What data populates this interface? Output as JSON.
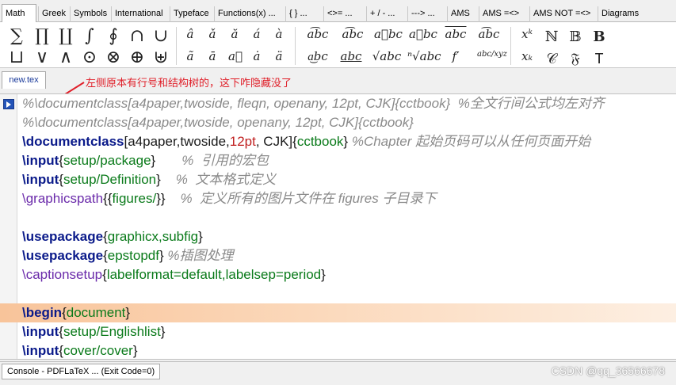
{
  "symbol_tabs": [
    "Math",
    "Greek",
    "Symbols",
    "International",
    "Typeface",
    "Functions(x) ...",
    "{ } ...",
    "<>= ...",
    "+ / - ...",
    "---> ...",
    "AMS",
    "AMS =<>",
    "AMS NOT =<>",
    "Diagrams"
  ],
  "symbols": {
    "row1": [
      "∑",
      "∏",
      "∐",
      "∫",
      "∮",
      "∩",
      "∪",
      "â",
      "ǎ",
      "ă",
      "á",
      "à",
      "a͡bc",
      "a͡bc",
      "a⃖bc",
      "a⃗bc",
      "abc",
      "a͡bc",
      "xᵏ",
      "ℕ",
      "𝔹",
      "B"
    ],
    "row2": [
      "⊔",
      "∨",
      "∧",
      "⊙",
      "⊗",
      "⊕",
      "⊎",
      "ã",
      "ā",
      "a⃗",
      "ȧ",
      "ä",
      "a͜bc",
      "abc",
      "√abc",
      "ⁿ√abc",
      "f′",
      "abc/xyz",
      "xₖ",
      "𝒞",
      "𝔉",
      "T"
    ]
  },
  "file_tab": "new.tex",
  "annotation": "左侧原本有行号和结构树的，这下咋隐藏没了",
  "editor_lines": [
    "%\\documentclass[a4paper,twoside, fleqn, openany, 12pt, CJK]{cctbook}  %全文行间公式均左对齐",
    "%\\documentclass[a4paper,twoside, openany, 12pt, CJK]{cctbook}",
    "\\documentclass[a4paper,twoside,12pt, CJK]{cctbook} %Chapter 起始页码可以从任何页面开始",
    "\\input{setup/package}       %  引用的宏包",
    "\\input{setup/Definition}    %  文本格式定义",
    "\\graphicspath{{figures/}}    %  定义所有的图片文件在 figures 子目录下",
    "",
    "\\usepackage{graphicx,subfig}",
    "\\usepackage{epstopdf} %插图处理",
    "\\captionsetup{labelformat=default,labelsep=period}",
    "",
    "\\begin{document}",
    "\\input{setup/Englishlist}",
    "\\input{cover/cover}"
  ],
  "console": "Console - PDFLaTeX ... (Exit Code=0)",
  "watermark": "CSDN @qq_36566678",
  "colors": {
    "annotation": "#e0202a",
    "highlight": "#f8c49a",
    "command": "#0a1a8a",
    "argument": "#0a7a1a",
    "comment": "#8a8a8a"
  }
}
